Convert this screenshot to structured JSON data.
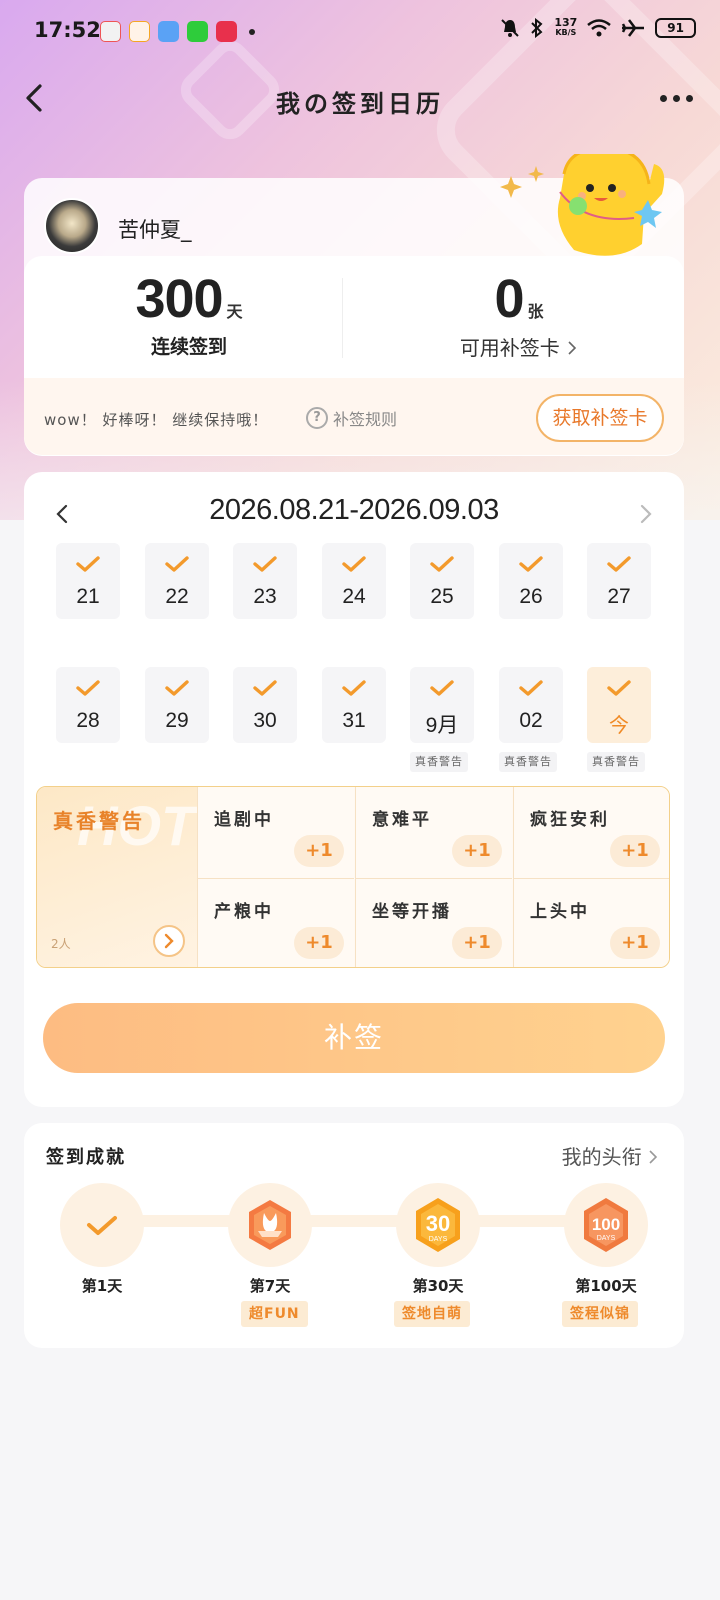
{
  "status_bar": {
    "time": "17:52",
    "speed_value": "137",
    "speed_unit": "KB/S",
    "battery": "91"
  },
  "nav": {
    "title": "我の签到日历"
  },
  "profile": {
    "username": "苦仲夏_",
    "streak_value": "300",
    "streak_unit": "天",
    "streak_label": "连续签到",
    "cards_value": "0",
    "cards_unit": "张",
    "cards_label": "可用补签卡",
    "tip": "wow！ 好棒呀！ 继续保持哦！",
    "rules_link": "补签规则",
    "get_card_button": "获取补签卡"
  },
  "calendar": {
    "range": "2026.08.21-2026.09.03",
    "days": [
      {
        "label": "21",
        "checked": true
      },
      {
        "label": "22",
        "checked": true
      },
      {
        "label": "23",
        "checked": true
      },
      {
        "label": "24",
        "checked": true
      },
      {
        "label": "25",
        "checked": true
      },
      {
        "label": "26",
        "checked": true
      },
      {
        "label": "27",
        "checked": true
      },
      {
        "label": "28",
        "checked": true
      },
      {
        "label": "29",
        "checked": true
      },
      {
        "label": "30",
        "checked": true
      },
      {
        "label": "31",
        "checked": true
      },
      {
        "label": "9月",
        "checked": true
      },
      {
        "label": "02",
        "checked": true
      },
      {
        "label": "今",
        "checked": true
      }
    ],
    "day_tags": [
      "真香警告",
      "真香警告",
      "真香警告"
    ],
    "accent_color": "#f39a2c"
  },
  "hot": {
    "watermark": "HOT",
    "title": "真香警告",
    "count": "2人",
    "cells": [
      {
        "label": "追剧中",
        "plus": "+1"
      },
      {
        "label": "意难平",
        "plus": "+1"
      },
      {
        "label": "疯狂安利",
        "plus": "+1"
      },
      {
        "label": "产粮中",
        "plus": "+1"
      },
      {
        "label": "坐等开播",
        "plus": "+1"
      },
      {
        "label": "上头中",
        "plus": "+1"
      }
    ]
  },
  "makeup_button": "补签",
  "achievements": {
    "title": "签到成就",
    "link": "我的头衔",
    "nodes": [
      {
        "label": "第1天",
        "badge": "",
        "icon": "check-icon"
      },
      {
        "label": "第7天",
        "badge": "超FUN",
        "icon": "bunny-badge-icon"
      },
      {
        "label": "第30天",
        "badge": "签地自萌",
        "icon": "30-days-badge-icon"
      },
      {
        "label": "第100天",
        "badge": "签程似锦",
        "icon": "100-days-badge-icon"
      }
    ]
  }
}
